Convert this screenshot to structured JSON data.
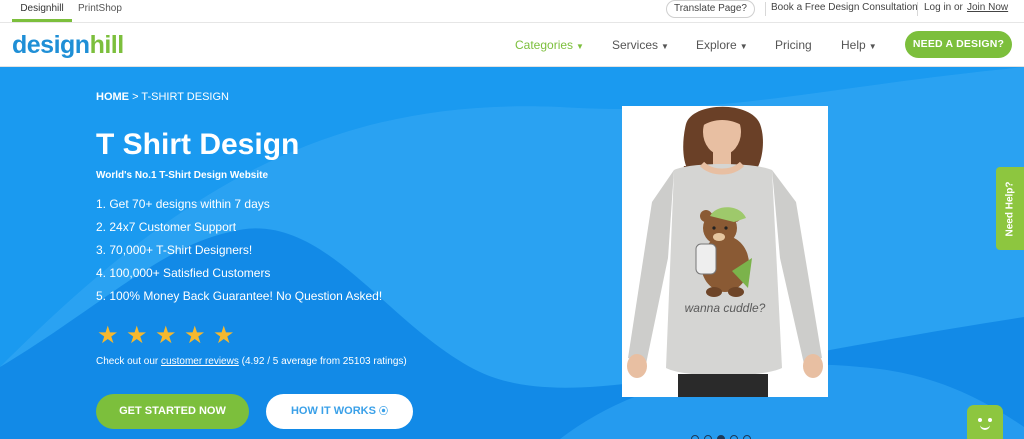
{
  "topbar": {
    "sites": [
      {
        "label": "Designhill",
        "active": true
      },
      {
        "label": "PrintShop",
        "active": false
      }
    ],
    "translate_label": "Translate Page?",
    "consult_label": "Book a Free Design Consultation",
    "login_label": "Log in",
    "or_label": "or",
    "join_label": "Join Now"
  },
  "nav": {
    "logo_part1": "design",
    "logo_part2": "hill",
    "items": [
      {
        "label": "Categories",
        "has_caret": true,
        "active": true
      },
      {
        "label": "Services",
        "has_caret": true,
        "active": false
      },
      {
        "label": "Explore",
        "has_caret": true,
        "active": false
      },
      {
        "label": "Pricing",
        "has_caret": false,
        "active": false
      },
      {
        "label": "Help",
        "has_caret": true,
        "active": false
      }
    ],
    "cta_label": "NEED A DESIGN?"
  },
  "hero": {
    "breadcrumb": {
      "home": "HOME",
      "separator": ">",
      "current": "T-SHIRT DESIGN"
    },
    "title": "T Shirt Design",
    "subtitle": "World's No.1 T-Shirt Design Website",
    "features": [
      "1. Get 70+ designs within 7 days",
      "2. 24x7 Customer Support",
      "3. 70,000+ T-Shirt Designers!",
      "4. 100,000+ Satisfied Customers",
      "5. 100% Money Back Guarantee! No Question Asked!"
    ],
    "rating_stars": 5,
    "reviews_prefix": "Check out our",
    "reviews_link": "customer reviews",
    "reviews_suffix": "(4.92 / 5 average from 25103 ratings)",
    "primary_cta": "GET STARTED NOW",
    "secondary_cta": "HOW IT WORKS",
    "shirt_print_text": "wanna cuddle?",
    "carousel": {
      "slides": 5,
      "active_index": 2
    }
  },
  "widgets": {
    "need_help_label": "Need Help?"
  },
  "colors": {
    "brand_blue": "#1f8fd6",
    "brand_green": "#7cbf3c",
    "hero_blue": "#1a9af0",
    "star_yellow": "#f5b82e"
  },
  "icons": {
    "caret": "chevron-down-icon",
    "star": "star-icon",
    "play": "play-circle-icon",
    "chat": "chatbot-icon"
  }
}
